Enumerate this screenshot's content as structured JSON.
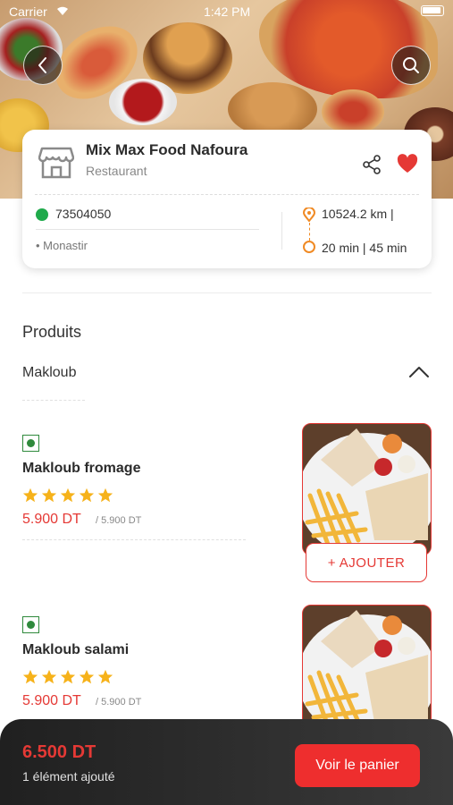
{
  "status_bar": {
    "carrier": "Carrier",
    "time": "1:42 PM"
  },
  "restaurant": {
    "name": "Mix Max Food Nafoura",
    "type": "Restaurant",
    "phone": "73504050",
    "city": "• Monastir",
    "distance": "10524.2 km |",
    "duration": "20 min | 45 min"
  },
  "section": {
    "title": "Produits",
    "category": "Makloub"
  },
  "products": [
    {
      "name": "Makloub fromage",
      "price": "5.900 DT",
      "old_price": "/ 5.900 DT",
      "rating": 5,
      "add_label": "+ AJOUTER"
    },
    {
      "name": "Makloub salami",
      "price": "5.900 DT",
      "old_price": "/ 5.900 DT",
      "rating": 5
    }
  ],
  "cart": {
    "total": "6.500 DT",
    "count": "1 élément ajouté",
    "button": "Voir le panier"
  },
  "colors": {
    "accent": "#e53935",
    "button": "#ee2e2e",
    "phone_icon": "#1faa4b",
    "pin": "#f08a24",
    "veg": "#2f8a3c",
    "star": "#f6b21a"
  },
  "icons": [
    "back-icon",
    "search-icon",
    "store-icon",
    "share-icon",
    "heart-icon",
    "whatsapp-icon",
    "location-pin-icon",
    "clock-icon",
    "chevron-up-icon",
    "veg-icon",
    "star-icon"
  ]
}
